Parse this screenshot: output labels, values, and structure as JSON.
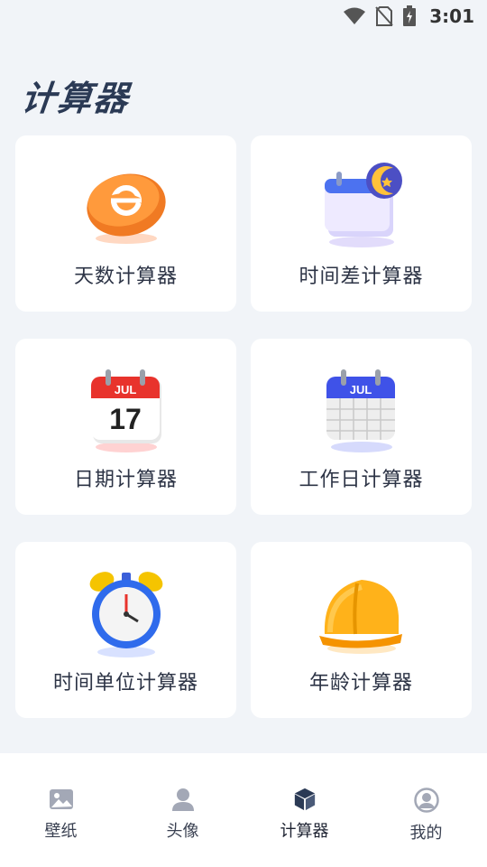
{
  "status_bar": {
    "time": "3:01"
  },
  "page": {
    "title": "计算器"
  },
  "cards": [
    {
      "label": "天数计算器",
      "icon": "orange-disc-icon"
    },
    {
      "label": "时间差计算器",
      "icon": "calendar-moon-icon"
    },
    {
      "label": "日期计算器",
      "icon": "red-calendar-icon",
      "calendar_month": "JUL",
      "calendar_day": "17"
    },
    {
      "label": "工作日计算器",
      "icon": "blue-calendar-icon",
      "calendar_month": "JUL"
    },
    {
      "label": "时间单位计算器",
      "icon": "alarm-clock-icon"
    },
    {
      "label": "年龄计算器",
      "icon": "hard-hat-icon"
    }
  ],
  "bottom_nav": [
    {
      "label": "壁纸",
      "icon": "image-icon",
      "active": false
    },
    {
      "label": "头像",
      "icon": "person-icon",
      "active": false
    },
    {
      "label": "计算器",
      "icon": "cube-icon",
      "active": true
    },
    {
      "label": "我的",
      "icon": "profile-circle-icon",
      "active": false
    }
  ],
  "colors": {
    "background": "#f1f4f8",
    "title": "#2b3a55",
    "card": "#ffffff"
  }
}
